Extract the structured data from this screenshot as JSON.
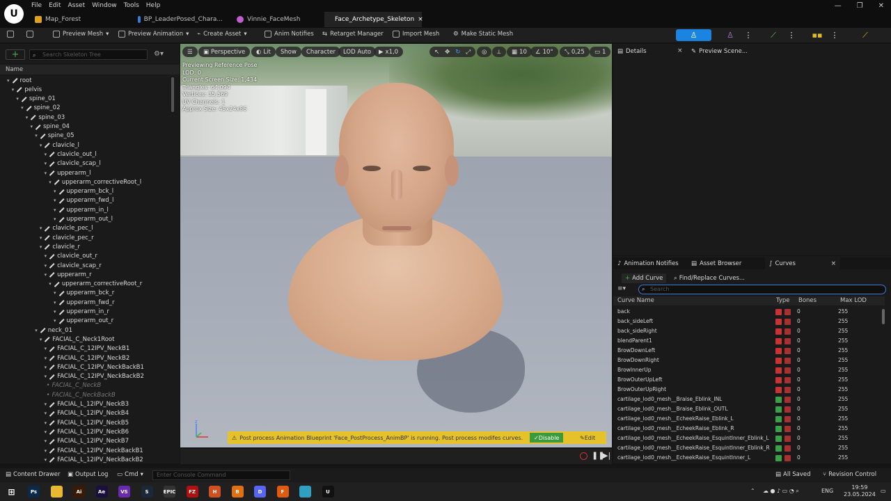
{
  "window": {
    "menu": [
      "File",
      "Edit",
      "Asset",
      "Window",
      "Tools",
      "Help"
    ],
    "tabs": [
      {
        "label": "Map_Forest",
        "color": "#e0a020"
      },
      {
        "label": "BP_LeaderPosed_Chara...",
        "color": "#3a7bd5"
      },
      {
        "label": "Vinnie_FaceMesh",
        "color": "#c060d0"
      },
      {
        "label": "Face_Archetype_Skeleton",
        "color": "#40b0d0",
        "active": true,
        "close": "×"
      }
    ],
    "controls": [
      "—",
      "❐",
      "✕"
    ]
  },
  "toolbar": {
    "preview_mesh": "Preview Mesh",
    "preview_animation": "Preview Animation",
    "create_asset": "Create Asset",
    "anim_notifies": "Anim Notifies",
    "retarget_manager": "Retarget Manager",
    "import_mesh": "Import Mesh",
    "make_static_mesh": "Make Static Mesh",
    "accent": "#1a84e0"
  },
  "skeleton_tree": {
    "search_placeholder": "Search Skeleton Tree",
    "column": "Name",
    "bones": [
      {
        "name": "root",
        "d": 0
      },
      {
        "name": "pelvis",
        "d": 1
      },
      {
        "name": "spine_01",
        "d": 2
      },
      {
        "name": "spine_02",
        "d": 3
      },
      {
        "name": "spine_03",
        "d": 4
      },
      {
        "name": "spine_04",
        "d": 5
      },
      {
        "name": "spine_05",
        "d": 6
      },
      {
        "name": "clavicle_l",
        "d": 7
      },
      {
        "name": "clavicle_out_l",
        "d": 8
      },
      {
        "name": "clavicle_scap_l",
        "d": 8
      },
      {
        "name": "upperarm_l",
        "d": 8
      },
      {
        "name": "upperarm_correctiveRoot_l",
        "d": 9
      },
      {
        "name": "upperarm_bck_l",
        "d": 10
      },
      {
        "name": "upperarm_fwd_l",
        "d": 10
      },
      {
        "name": "upperarm_in_l",
        "d": 10
      },
      {
        "name": "upperarm_out_l",
        "d": 10
      },
      {
        "name": "clavicle_pec_l",
        "d": 7
      },
      {
        "name": "clavicle_pec_r",
        "d": 7
      },
      {
        "name": "clavicle_r",
        "d": 7
      },
      {
        "name": "clavicle_out_r",
        "d": 8
      },
      {
        "name": "clavicle_scap_r",
        "d": 8
      },
      {
        "name": "upperarm_r",
        "d": 8
      },
      {
        "name": "upperarm_correctiveRoot_r",
        "d": 9
      },
      {
        "name": "upperarm_bck_r",
        "d": 10
      },
      {
        "name": "upperarm_fwd_r",
        "d": 10
      },
      {
        "name": "upperarm_in_r",
        "d": 10
      },
      {
        "name": "upperarm_out_r",
        "d": 10
      },
      {
        "name": "neck_01",
        "d": 6
      },
      {
        "name": "FACIAL_C_Neck1Root",
        "d": 7
      },
      {
        "name": "FACIAL_C_12IPV_NeckB1",
        "d": 8
      },
      {
        "name": "FACIAL_C_12IPV_NeckB2",
        "d": 8
      },
      {
        "name": "FACIAL_C_12IPV_NeckBackB1",
        "d": 8
      },
      {
        "name": "FACIAL_C_12IPV_NeckBackB2",
        "d": 8
      },
      {
        "name": "FACIAL_C_NeckB",
        "d": 8,
        "faded": true
      },
      {
        "name": "FACIAL_C_NeckBackB",
        "d": 8,
        "faded": true
      },
      {
        "name": "FACIAL_L_12IPV_NeckB3",
        "d": 8
      },
      {
        "name": "FACIAL_L_12IPV_NeckB4",
        "d": 8
      },
      {
        "name": "FACIAL_L_12IPV_NeckB5",
        "d": 8
      },
      {
        "name": "FACIAL_L_12IPV_NeckB6",
        "d": 8
      },
      {
        "name": "FACIAL_L_12IPV_NeckB7",
        "d": 8
      },
      {
        "name": "FACIAL_L_12IPV_NeckBackB1",
        "d": 8
      },
      {
        "name": "FACIAL_L_12IPV_NeckBackB2",
        "d": 8
      }
    ]
  },
  "viewport": {
    "menu_icon": "☰",
    "perspective": "Perspective",
    "lit": "Lit",
    "show": "Show",
    "character": "Character",
    "lod": "LOD Auto",
    "speed": "x1,0",
    "grid": "10",
    "angle": "10°",
    "scale": "0,25",
    "cams": "1",
    "info": [
      "Previewing Reference Pose",
      "LOD: 0",
      "Current Screen Size: 1,434",
      "Triangles: 64,094",
      "Vertices: 35,569",
      "UV Channels: 1",
      "Approx Size: 45x24x86"
    ],
    "warning": "Post process Animation Blueprint 'Face_PostProcess_AnimBP' is running. Post process modifes curves.",
    "disable": "Disable",
    "edit": "Edit"
  },
  "details": {
    "tab1": "Details",
    "tab2": "Preview Scene..."
  },
  "curves_panel": {
    "tabs": [
      "Animation Notifies",
      "Asset Browser",
      "Curves"
    ],
    "add_curve": "Add Curve",
    "find_replace": "Find/Replace Curves...",
    "search_placeholder": "Search",
    "columns": [
      "Curve Name",
      "Type",
      "Bones",
      "Max LOD"
    ],
    "rows": [
      {
        "name": "back",
        "type": "red",
        "bones": "0",
        "lod": "255"
      },
      {
        "name": "back_sideLeft",
        "type": "red",
        "bones": "0",
        "lod": "255"
      },
      {
        "name": "back_sideRight",
        "type": "red",
        "bones": "0",
        "lod": "255"
      },
      {
        "name": "blendParent1",
        "type": "red",
        "bones": "0",
        "lod": "255"
      },
      {
        "name": "BrowDownLeft",
        "type": "red",
        "bones": "0",
        "lod": "255"
      },
      {
        "name": "BrowDownRight",
        "type": "red",
        "bones": "0",
        "lod": "255"
      },
      {
        "name": "BrowInnerUp",
        "type": "red",
        "bones": "0",
        "lod": "255"
      },
      {
        "name": "BrowOuterUpLeft",
        "type": "red",
        "bones": "0",
        "lod": "255"
      },
      {
        "name": "BrowOuterUpRight",
        "type": "red",
        "bones": "0",
        "lod": "255"
      },
      {
        "name": "cartilage_lod0_mesh__Braise_Eblink_INL",
        "type": "green",
        "bones": "0",
        "lod": "255"
      },
      {
        "name": "cartilage_lod0_mesh__Braise_Eblink_OUTL",
        "type": "green",
        "bones": "0",
        "lod": "255"
      },
      {
        "name": "cartilage_lod0_mesh__EcheekRaise_Eblink_L",
        "type": "green",
        "bones": "0",
        "lod": "255"
      },
      {
        "name": "cartilage_lod0_mesh__EcheekRaise_Eblink_R",
        "type": "green",
        "bones": "0",
        "lod": "255"
      },
      {
        "name": "cartilage_lod0_mesh__EcheekRaise_EsquintInner_Eblink_L",
        "type": "green",
        "bones": "0",
        "lod": "255"
      },
      {
        "name": "cartilage_lod0_mesh__EcheekRaise_EsquintInner_Eblink_R",
        "type": "green",
        "bones": "0",
        "lod": "255"
      },
      {
        "name": "cartilage_lod0_mesh__EcheekRaise_EsquintInner_L",
        "type": "green",
        "bones": "0",
        "lod": "255"
      }
    ]
  },
  "statusbar": {
    "content_drawer": "Content Drawer",
    "output_log": "Output Log",
    "cmd": "Cmd",
    "console_placeholder": "Enter Console Command",
    "all_saved": "All Saved",
    "revision_control": "Revision Control"
  },
  "taskbar": {
    "apps": [
      {
        "icon": "ps-icon",
        "label": "Ps",
        "color": "#0a2a4a"
      },
      {
        "icon": "folder-icon",
        "label": "",
        "color": "#e8b830"
      },
      {
        "icon": "ai-icon",
        "label": "Ai",
        "color": "#3a1a00"
      },
      {
        "icon": "ae-icon",
        "label": "Ae",
        "color": "#1a1040"
      },
      {
        "icon": "vs-icon",
        "label": "VS",
        "color": "#6a2ab0"
      },
      {
        "icon": "steam-icon",
        "label": "S",
        "color": "#1b2838"
      },
      {
        "icon": "epic-icon",
        "label": "EPIC",
        "color": "#333"
      },
      {
        "icon": "filezilla-icon",
        "label": "FZ",
        "color": "#b01010"
      },
      {
        "icon": "houdini-icon",
        "label": "H",
        "color": "#d05020"
      },
      {
        "icon": "blender-icon",
        "label": "B",
        "color": "#e07010"
      },
      {
        "icon": "discord-icon",
        "label": "D",
        "color": "#5865f2"
      },
      {
        "icon": "firefox-icon",
        "label": "F",
        "color": "#e05a10"
      },
      {
        "icon": "app-icon",
        "label": "",
        "color": "#30a0c0"
      },
      {
        "icon": "unreal-icon",
        "label": "U",
        "color": "#111"
      }
    ],
    "lang": "ENG",
    "time": "19:59",
    "date": "23.05.2024"
  }
}
